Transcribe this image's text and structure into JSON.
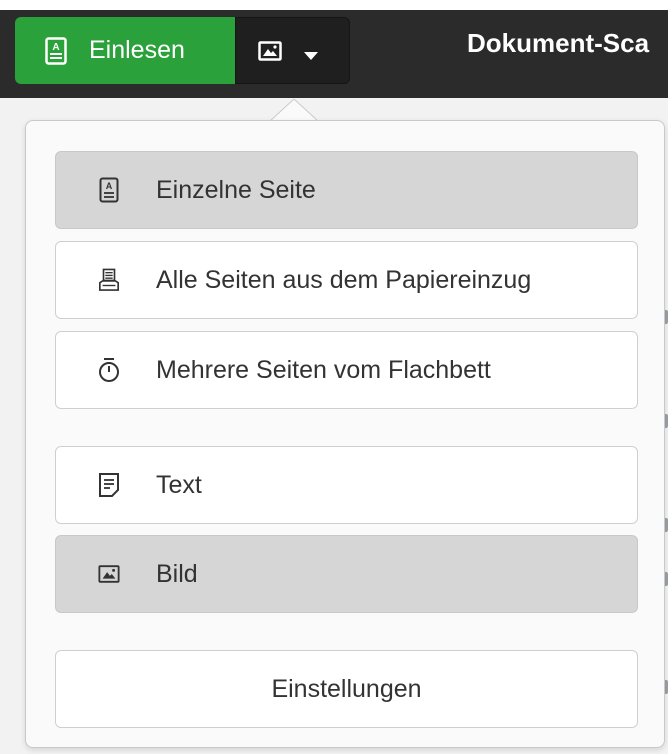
{
  "header": {
    "scan_label": "Einlesen",
    "title": "Dokument-Sca"
  },
  "menu": {
    "scan_types": [
      {
        "label": "Einzelne Seite",
        "icon": "single-page-icon",
        "active": true
      },
      {
        "label": "Alle Seiten aus dem Papiereinzug",
        "icon": "feeder-icon",
        "active": false
      },
      {
        "label": "Mehrere Seiten vom Flachbett",
        "icon": "timer-icon",
        "active": false
      }
    ],
    "scan_modes": [
      {
        "label": "Text",
        "icon": "text-document-icon",
        "active": false
      },
      {
        "label": "Bild",
        "icon": "image-icon",
        "active": true
      }
    ],
    "preferences_label": "Einstellungen"
  },
  "colors": {
    "accent_green": "#2aa13a",
    "header_dark": "#2b2b2b",
    "active_item": "#d6d6d6"
  }
}
